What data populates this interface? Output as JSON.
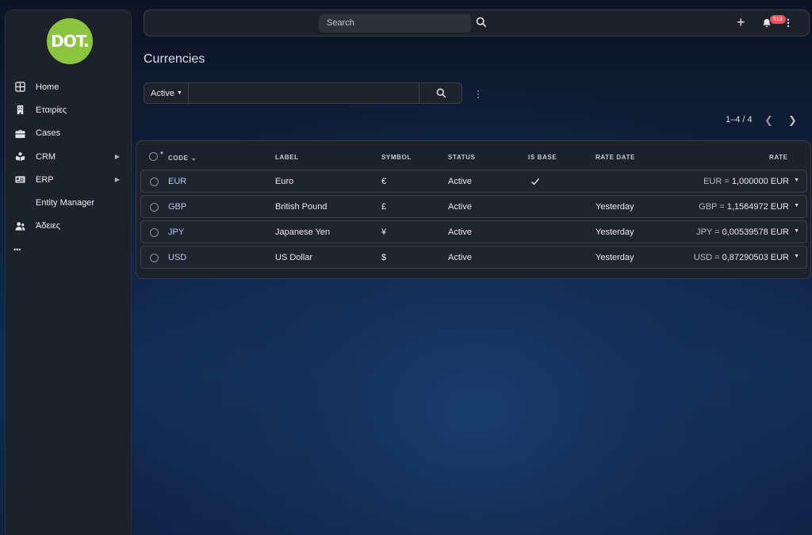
{
  "brand": {
    "logo_text": "DOT.",
    "logo_color": "#8cc43f"
  },
  "sidebar": {
    "items": [
      {
        "label": "Home",
        "icon": "grid-icon"
      },
      {
        "label": "Εταιρίες",
        "icon": "building-icon"
      },
      {
        "label": "Cases",
        "icon": "briefcase-icon"
      },
      {
        "label": "CRM",
        "icon": "book-icon",
        "has_submenu": true
      },
      {
        "label": "ERP",
        "icon": "id-card-icon",
        "has_submenu": true
      },
      {
        "label": "Entity Manager",
        "icon": ""
      },
      {
        "label": "Άδειες",
        "icon": "users-icon"
      },
      {
        "label": "•••",
        "icon": "more-icon"
      }
    ]
  },
  "topbar": {
    "search_placeholder": "Search",
    "notification_count": "513"
  },
  "page": {
    "title": "Currencies"
  },
  "filter": {
    "selected": "Active"
  },
  "pagination": {
    "text": "1–4 / 4"
  },
  "table": {
    "columns": [
      "CODE",
      "LABEL",
      "SYMBOL",
      "STATUS",
      "IS BASE",
      "RATE DATE",
      "RATE"
    ],
    "rows": [
      {
        "code": "EUR",
        "label": "Euro",
        "symbol": "€",
        "status": "Active",
        "is_base": true,
        "rate_date": "",
        "rate_prefix": "EUR = ",
        "rate_value": "1,000000 EUR"
      },
      {
        "code": "GBP",
        "label": "British Pound",
        "symbol": "£",
        "status": "Active",
        "is_base": false,
        "rate_date": "Yesterday",
        "rate_prefix": "GBP = ",
        "rate_value": "1,1564972 EUR"
      },
      {
        "code": "JPY",
        "label": "Japanese Yen",
        "symbol": "¥",
        "status": "Active",
        "is_base": false,
        "rate_date": "Yesterday",
        "rate_prefix": "JPY = ",
        "rate_value": "0,00539578 EUR"
      },
      {
        "code": "USD",
        "label": "US Dollar",
        "symbol": "$",
        "status": "Active",
        "is_base": false,
        "rate_date": "Yesterday",
        "rate_prefix": "USD = ",
        "rate_value": "0,87290503 EUR"
      }
    ]
  }
}
